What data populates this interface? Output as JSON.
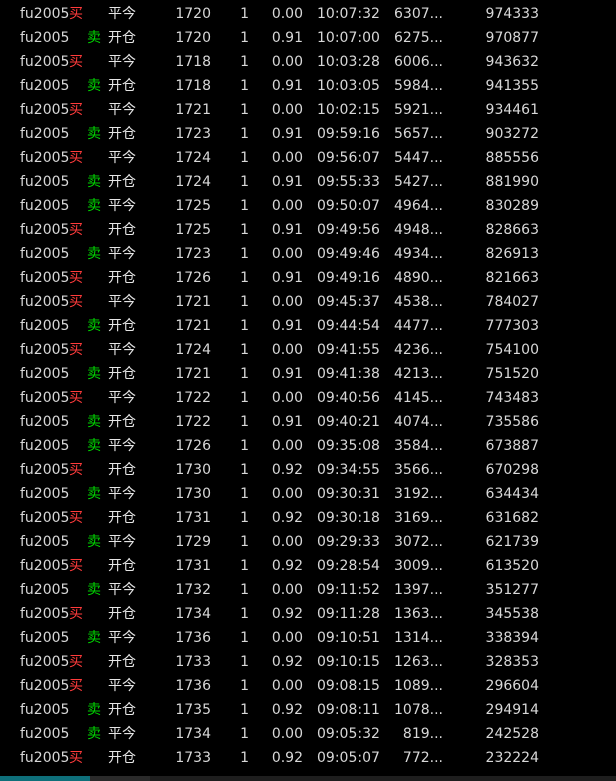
{
  "colors": {
    "background": "#000000",
    "text": "#d8d8d8",
    "buy": "#ff3b3b",
    "sell": "#00d400",
    "status_bar_accent": "#0e6f7a"
  },
  "trades": [
    {
      "code": "fu2005",
      "side": "买",
      "side_type": "buy",
      "action": "平今",
      "price": "1720",
      "volume": "1",
      "rate": "0.00",
      "time": "10:07:32",
      "open_interest": "6307...",
      "total": "974333"
    },
    {
      "code": "fu2005",
      "side": "卖",
      "side_type": "sell",
      "action": "开仓",
      "price": "1720",
      "volume": "1",
      "rate": "0.91",
      "time": "10:07:00",
      "open_interest": "6275...",
      "total": "970877"
    },
    {
      "code": "fu2005",
      "side": "买",
      "side_type": "buy",
      "action": "平今",
      "price": "1718",
      "volume": "1",
      "rate": "0.00",
      "time": "10:03:28",
      "open_interest": "6006...",
      "total": "943632"
    },
    {
      "code": "fu2005",
      "side": "卖",
      "side_type": "sell",
      "action": "开仓",
      "price": "1718",
      "volume": "1",
      "rate": "0.91",
      "time": "10:03:05",
      "open_interest": "5984...",
      "total": "941355"
    },
    {
      "code": "fu2005",
      "side": "买",
      "side_type": "buy",
      "action": "平今",
      "price": "1721",
      "volume": "1",
      "rate": "0.00",
      "time": "10:02:15",
      "open_interest": "5921...",
      "total": "934461"
    },
    {
      "code": "fu2005",
      "side": "卖",
      "side_type": "sell",
      "action": "开仓",
      "price": "1723",
      "volume": "1",
      "rate": "0.91",
      "time": "09:59:16",
      "open_interest": "5657...",
      "total": "903272"
    },
    {
      "code": "fu2005",
      "side": "买",
      "side_type": "buy",
      "action": "平今",
      "price": "1724",
      "volume": "1",
      "rate": "0.00",
      "time": "09:56:07",
      "open_interest": "5447...",
      "total": "885556"
    },
    {
      "code": "fu2005",
      "side": "卖",
      "side_type": "sell",
      "action": "开仓",
      "price": "1724",
      "volume": "1",
      "rate": "0.91",
      "time": "09:55:33",
      "open_interest": "5427...",
      "total": "881990"
    },
    {
      "code": "fu2005",
      "side": "卖",
      "side_type": "sell",
      "action": "平今",
      "price": "1725",
      "volume": "1",
      "rate": "0.00",
      "time": "09:50:07",
      "open_interest": "4964...",
      "total": "830289"
    },
    {
      "code": "fu2005",
      "side": "买",
      "side_type": "buy",
      "action": "开仓",
      "price": "1725",
      "volume": "1",
      "rate": "0.91",
      "time": "09:49:56",
      "open_interest": "4948...",
      "total": "828663"
    },
    {
      "code": "fu2005",
      "side": "卖",
      "side_type": "sell",
      "action": "平今",
      "price": "1723",
      "volume": "1",
      "rate": "0.00",
      "time": "09:49:46",
      "open_interest": "4934...",
      "total": "826913"
    },
    {
      "code": "fu2005",
      "side": "买",
      "side_type": "buy",
      "action": "开仓",
      "price": "1726",
      "volume": "1",
      "rate": "0.91",
      "time": "09:49:16",
      "open_interest": "4890...",
      "total": "821663"
    },
    {
      "code": "fu2005",
      "side": "买",
      "side_type": "buy",
      "action": "平今",
      "price": "1721",
      "volume": "1",
      "rate": "0.00",
      "time": "09:45:37",
      "open_interest": "4538...",
      "total": "784027"
    },
    {
      "code": "fu2005",
      "side": "卖",
      "side_type": "sell",
      "action": "开仓",
      "price": "1721",
      "volume": "1",
      "rate": "0.91",
      "time": "09:44:54",
      "open_interest": "4477...",
      "total": "777303"
    },
    {
      "code": "fu2005",
      "side": "买",
      "side_type": "buy",
      "action": "平今",
      "price": "1724",
      "volume": "1",
      "rate": "0.00",
      "time": "09:41:55",
      "open_interest": "4236...",
      "total": "754100"
    },
    {
      "code": "fu2005",
      "side": "卖",
      "side_type": "sell",
      "action": "开仓",
      "price": "1721",
      "volume": "1",
      "rate": "0.91",
      "time": "09:41:38",
      "open_interest": "4213...",
      "total": "751520"
    },
    {
      "code": "fu2005",
      "side": "买",
      "side_type": "buy",
      "action": "平今",
      "price": "1722",
      "volume": "1",
      "rate": "0.00",
      "time": "09:40:56",
      "open_interest": "4145...",
      "total": "743483"
    },
    {
      "code": "fu2005",
      "side": "卖",
      "side_type": "sell",
      "action": "开仓",
      "price": "1722",
      "volume": "1",
      "rate": "0.91",
      "time": "09:40:21",
      "open_interest": "4074...",
      "total": "735586"
    },
    {
      "code": "fu2005",
      "side": "卖",
      "side_type": "sell",
      "action": "平今",
      "price": "1726",
      "volume": "1",
      "rate": "0.00",
      "time": "09:35:08",
      "open_interest": "3584...",
      "total": "673887"
    },
    {
      "code": "fu2005",
      "side": "买",
      "side_type": "buy",
      "action": "开仓",
      "price": "1730",
      "volume": "1",
      "rate": "0.92",
      "time": "09:34:55",
      "open_interest": "3566...",
      "total": "670298"
    },
    {
      "code": "fu2005",
      "side": "卖",
      "side_type": "sell",
      "action": "平今",
      "price": "1730",
      "volume": "1",
      "rate": "0.00",
      "time": "09:30:31",
      "open_interest": "3192...",
      "total": "634434"
    },
    {
      "code": "fu2005",
      "side": "买",
      "side_type": "buy",
      "action": "开仓",
      "price": "1731",
      "volume": "1",
      "rate": "0.92",
      "time": "09:30:18",
      "open_interest": "3169...",
      "total": "631682"
    },
    {
      "code": "fu2005",
      "side": "卖",
      "side_type": "sell",
      "action": "平今",
      "price": "1729",
      "volume": "1",
      "rate": "0.00",
      "time": "09:29:33",
      "open_interest": "3072...",
      "total": "621739"
    },
    {
      "code": "fu2005",
      "side": "买",
      "side_type": "buy",
      "action": "开仓",
      "price": "1731",
      "volume": "1",
      "rate": "0.92",
      "time": "09:28:54",
      "open_interest": "3009...",
      "total": "613520"
    },
    {
      "code": "fu2005",
      "side": "卖",
      "side_type": "sell",
      "action": "平今",
      "price": "1732",
      "volume": "1",
      "rate": "0.00",
      "time": "09:11:52",
      "open_interest": "1397...",
      "total": "351277"
    },
    {
      "code": "fu2005",
      "side": "买",
      "side_type": "buy",
      "action": "开仓",
      "price": "1734",
      "volume": "1",
      "rate": "0.92",
      "time": "09:11:28",
      "open_interest": "1363...",
      "total": "345538"
    },
    {
      "code": "fu2005",
      "side": "卖",
      "side_type": "sell",
      "action": "平今",
      "price": "1736",
      "volume": "1",
      "rate": "0.00",
      "time": "09:10:51",
      "open_interest": "1314...",
      "total": "338394"
    },
    {
      "code": "fu2005",
      "side": "买",
      "side_type": "buy",
      "action": "开仓",
      "price": "1733",
      "volume": "1",
      "rate": "0.92",
      "time": "09:10:15",
      "open_interest": "1263...",
      "total": "328353"
    },
    {
      "code": "fu2005",
      "side": "买",
      "side_type": "buy",
      "action": "平今",
      "price": "1736",
      "volume": "1",
      "rate": "0.00",
      "time": "09:08:15",
      "open_interest": "1089...",
      "total": "296604"
    },
    {
      "code": "fu2005",
      "side": "卖",
      "side_type": "sell",
      "action": "开仓",
      "price": "1735",
      "volume": "1",
      "rate": "0.92",
      "time": "09:08:11",
      "open_interest": "1078...",
      "total": "294914"
    },
    {
      "code": "fu2005",
      "side": "卖",
      "side_type": "sell",
      "action": "平今",
      "price": "1734",
      "volume": "1",
      "rate": "0.00",
      "time": "09:05:32",
      "open_interest": "819...",
      "total": "242528"
    },
    {
      "code": "fu2005",
      "side": "买",
      "side_type": "buy",
      "action": "开仓",
      "price": "1733",
      "volume": "1",
      "rate": "0.92",
      "time": "09:05:07",
      "open_interest": "772...",
      "total": "232224"
    }
  ]
}
